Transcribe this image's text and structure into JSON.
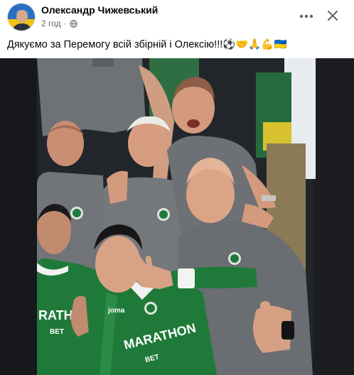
{
  "post": {
    "author": "Олександр Чижевський",
    "time": "2 год",
    "separator": "·",
    "privacy_icon": "globe-icon",
    "more_icon": "more-horizontal-icon",
    "close_icon": "close-icon",
    "text": "Дякуємо за Перемогу всій збірній і Олексію!!!",
    "emoji": "⚽🤝🙏💪🇺🇦"
  },
  "photo": {
    "jersey_text_line1": "MARATHON",
    "jersey_text_line2": "BET",
    "left_jersey_text": "RATHON",
    "left_jersey_bet": "BET",
    "brand": "joma"
  },
  "colors": {
    "accent_green": "#1f7a3a",
    "shirt_grey": "#6b6e72",
    "text_secondary": "#65676b"
  }
}
